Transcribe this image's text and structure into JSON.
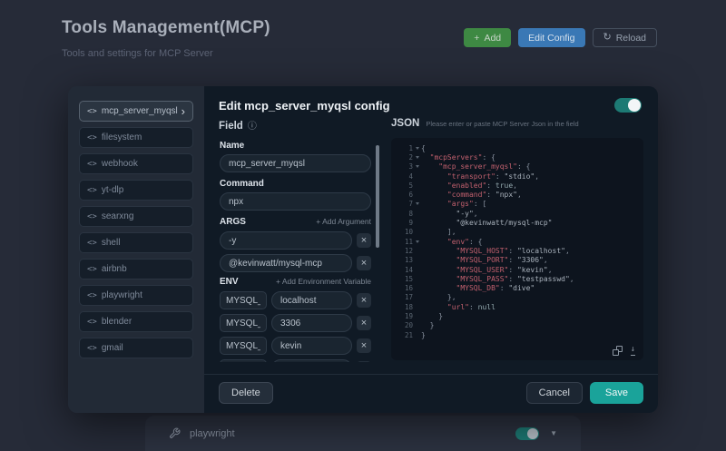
{
  "header": {
    "title": "Tools Management(MCP)",
    "subtitle": "Tools and settings for MCP Server",
    "buttons": {
      "add": "Add",
      "add_plus": "+",
      "edit_config": "Edit Config",
      "reload": "Reload",
      "reload_glyph": "↻"
    }
  },
  "server_list": {
    "icon_glyph": "<>",
    "selected_arrow": "›",
    "items": [
      {
        "label": "mcp_server_myqsl",
        "selected": true
      },
      {
        "label": "filesystem",
        "selected": false
      },
      {
        "label": "webhook",
        "selected": false
      },
      {
        "label": "yt-dlp",
        "selected": false
      },
      {
        "label": "searxng",
        "selected": false
      },
      {
        "label": "shell",
        "selected": false
      },
      {
        "label": "airbnb",
        "selected": false
      },
      {
        "label": "playwright",
        "selected": false
      },
      {
        "label": "blender",
        "selected": false
      },
      {
        "label": "gmail",
        "selected": false
      }
    ]
  },
  "dialog": {
    "title": "Edit mcp_server_myqsl config",
    "toggle_on": true,
    "field_panel": {
      "heading": "Field",
      "info_glyph": "ⓘ",
      "name_label": "Name",
      "name_value": "mcp_server_myqsl",
      "command_label": "Command",
      "command_value": "npx",
      "args_label": "ARGS",
      "add_argument": "+ Add Argument",
      "args": [
        "-y",
        "@kevinwatt/mysql-mcp"
      ],
      "env_label": "ENV",
      "add_env": "+ Add Environment Variable",
      "env": [
        {
          "key": "MYSQL_HOST",
          "value": "localhost"
        },
        {
          "key": "MYSQL_PORT",
          "value": "3306"
        },
        {
          "key": "MYSQL_USER",
          "value": "kevin"
        },
        {
          "key": "MYSQL_PASS",
          "value": "testpasswd"
        },
        {
          "key": "MYSQL_DB",
          "value": "dive"
        }
      ],
      "remove_glyph": "×"
    },
    "json_panel": {
      "heading": "JSON",
      "hint": "Please enter or paste MCP Server Json in the field",
      "fold_lines": [
        1,
        2,
        3,
        7,
        11
      ],
      "lines": [
        [
          [
            "p",
            "{"
          ]
        ],
        [
          [
            "p",
            "  "
          ],
          [
            "k",
            "\"mcpServers\""
          ],
          [
            "p",
            ": {"
          ]
        ],
        [
          [
            "p",
            "    "
          ],
          [
            "k",
            "\"mcp_server_myqsl\""
          ],
          [
            "p",
            ": {"
          ]
        ],
        [
          [
            "p",
            "      "
          ],
          [
            "k",
            "\"transport\""
          ],
          [
            "p",
            ": "
          ],
          [
            "s",
            "\"stdio\""
          ],
          [
            "p",
            ","
          ]
        ],
        [
          [
            "p",
            "      "
          ],
          [
            "k",
            "\"enabled\""
          ],
          [
            "p",
            ": "
          ],
          [
            "w",
            "true"
          ],
          [
            "p",
            ","
          ]
        ],
        [
          [
            "p",
            "      "
          ],
          [
            "k",
            "\"command\""
          ],
          [
            "p",
            ": "
          ],
          [
            "s",
            "\"npx\""
          ],
          [
            "p",
            ","
          ]
        ],
        [
          [
            "p",
            "      "
          ],
          [
            "k",
            "\"args\""
          ],
          [
            "p",
            ": ["
          ]
        ],
        [
          [
            "p",
            "        "
          ],
          [
            "s",
            "\"-y\""
          ],
          [
            "p",
            ","
          ]
        ],
        [
          [
            "p",
            "        "
          ],
          [
            "s",
            "\"@kevinwatt/mysql-mcp\""
          ]
        ],
        [
          [
            "p",
            "      ],"
          ]
        ],
        [
          [
            "p",
            "      "
          ],
          [
            "k",
            "\"env\""
          ],
          [
            "p",
            ": {"
          ]
        ],
        [
          [
            "p",
            "        "
          ],
          [
            "k",
            "\"MYSQL_HOST\""
          ],
          [
            "p",
            ": "
          ],
          [
            "s",
            "\"localhost\""
          ],
          [
            "p",
            ","
          ]
        ],
        [
          [
            "p",
            "        "
          ],
          [
            "k",
            "\"MYSQL_PORT\""
          ],
          [
            "p",
            ": "
          ],
          [
            "s",
            "\"3306\""
          ],
          [
            "p",
            ","
          ]
        ],
        [
          [
            "p",
            "        "
          ],
          [
            "k",
            "\"MYSQL_USER\""
          ],
          [
            "p",
            ": "
          ],
          [
            "s",
            "\"kevin\""
          ],
          [
            "p",
            ","
          ]
        ],
        [
          [
            "p",
            "        "
          ],
          [
            "k",
            "\"MYSQL_PASS\""
          ],
          [
            "p",
            ": "
          ],
          [
            "s",
            "\"testpasswd\""
          ],
          [
            "p",
            ","
          ]
        ],
        [
          [
            "p",
            "        "
          ],
          [
            "k",
            "\"MYSQL_DB\""
          ],
          [
            "p",
            ": "
          ],
          [
            "s",
            "\"dive\""
          ]
        ],
        [
          [
            "p",
            "      },"
          ]
        ],
        [
          [
            "p",
            "      "
          ],
          [
            "k",
            "\"url\""
          ],
          [
            "p",
            ": "
          ],
          [
            "w",
            "null"
          ]
        ],
        [
          [
            "p",
            "    }"
          ]
        ],
        [
          [
            "p",
            "  }"
          ]
        ],
        [
          [
            "p",
            "}"
          ]
        ]
      ]
    },
    "footer": {
      "delete": "Delete",
      "cancel": "Cancel",
      "save": "Save"
    }
  },
  "background_row": {
    "label": "playwright",
    "toggle_on": true,
    "dropdown_glyph": "▼"
  },
  "colors": {
    "accent_teal": "#1aa39a",
    "toggle_teal": "#1d7a74",
    "add_green": "#3e8943",
    "edit_blue": "#3a78b5",
    "json_key": "#c2606e",
    "json_string": "#a9b2bc"
  }
}
